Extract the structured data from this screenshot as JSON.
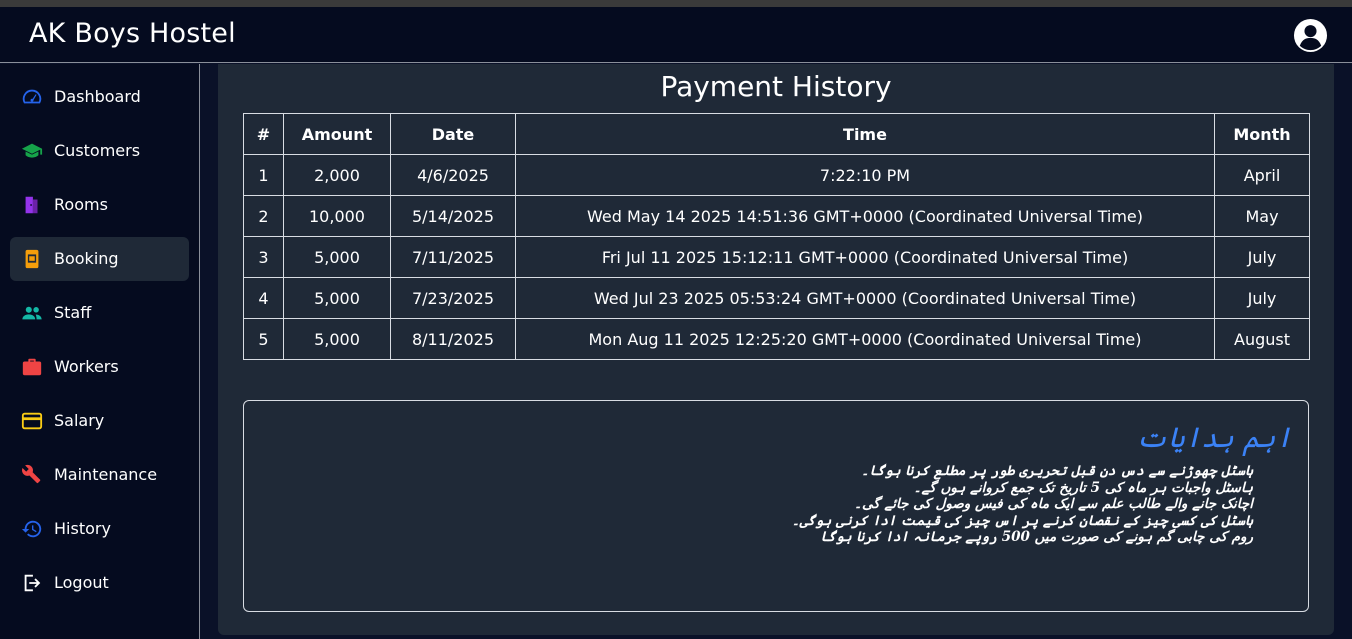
{
  "header": {
    "brand": "AK Boys Hostel"
  },
  "sidebar": {
    "items": [
      {
        "label": "Dashboard",
        "icon": "dashboard-icon",
        "color": "#2563eb"
      },
      {
        "label": "Customers",
        "icon": "graduation-cap-icon",
        "color": "#16a34a"
      },
      {
        "label": "Rooms",
        "icon": "door-icon",
        "color": "#9333ea"
      },
      {
        "label": "Booking",
        "icon": "booking-icon",
        "color": "#f59e0b",
        "active": true
      },
      {
        "label": "Staff",
        "icon": "people-icon",
        "color": "#14b8a6"
      },
      {
        "label": "Workers",
        "icon": "briefcase-icon",
        "color": "#ef4444"
      },
      {
        "label": "Salary",
        "icon": "credit-card-icon",
        "color": "#facc15"
      },
      {
        "label": "Maintenance",
        "icon": "wrench-icon",
        "color": "#ef4444"
      },
      {
        "label": "History",
        "icon": "history-icon",
        "color": "#2563eb"
      },
      {
        "label": "Logout",
        "icon": "logout-icon",
        "color": "#ffffff"
      }
    ]
  },
  "main": {
    "title": "Payment History",
    "table": {
      "headers": [
        "#",
        "Amount",
        "Date",
        "Time",
        "Month"
      ],
      "rows": [
        [
          "1",
          "2,000",
          "4/6/2025",
          "7:22:10 PM",
          "April"
        ],
        [
          "2",
          "10,000",
          "5/14/2025",
          "Wed May 14 2025 14:51:36 GMT+0000 (Coordinated Universal Time)",
          "May"
        ],
        [
          "3",
          "5,000",
          "7/11/2025",
          "Fri Jul 11 2025 15:12:11 GMT+0000 (Coordinated Universal Time)",
          "July"
        ],
        [
          "4",
          "5,000",
          "7/23/2025",
          "Wed Jul 23 2025 05:53:24 GMT+0000 (Coordinated Universal Time)",
          "July"
        ],
        [
          "5",
          "5,000",
          "8/11/2025",
          "Mon Aug 11 2025 12:25:20 GMT+0000 (Coordinated Universal Time)",
          "August"
        ]
      ]
    },
    "notice": {
      "title": "اہم ہدایات",
      "lines": [
        "ہاسٹل چھوڑنے سے دس دن قبل تحریری طور پر مطلع کرنا ہوگا۔",
        "ہاسٹل واجبات ہر ماہ کی 5 تاریخ تک جمع کروانے ہوں گے۔",
        "اچانک جانے والے طالب علم سے ایک ماہ کی فیس وصول کی جائے گی۔",
        "ہاسٹل کی کسی چیز کے نقصان کرنے پر اس چیز کی قیمت ادا کرنی ہوگی۔",
        "روم کی چابی گم ہونے کی صورت میں 500 روپے جرمانہ ادا کرنا ہوگا"
      ]
    }
  }
}
